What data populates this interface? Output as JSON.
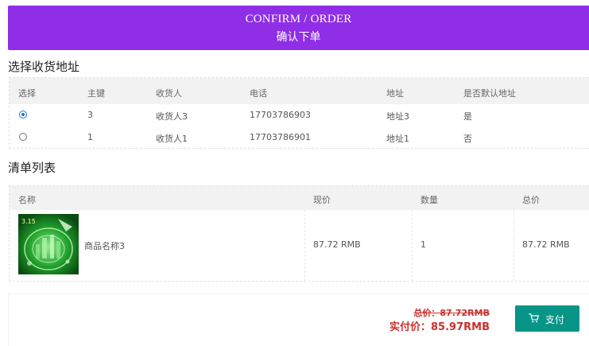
{
  "banner": {
    "title_en": "CONFIRM / ORDER",
    "title_zh": "确认下单"
  },
  "address": {
    "title": "选择收货地址",
    "columns": [
      "选择",
      "主键",
      "收货人",
      "电话",
      "地址",
      "是否默认地址"
    ],
    "rows": [
      {
        "selected": true,
        "id": "3",
        "receiver": "收货人3",
        "phone": "17703786903",
        "address": "地址3",
        "is_default": "是"
      },
      {
        "selected": false,
        "id": "1",
        "receiver": "收货人1",
        "phone": "17703786901",
        "address": "地址1",
        "is_default": "否"
      }
    ]
  },
  "cart": {
    "title": "清单列表",
    "columns": [
      "名称",
      "现价",
      "数量",
      "总价"
    ],
    "items": [
      {
        "name": "商品名称3",
        "price": "87.72 RMB",
        "quantity": "1",
        "total": "87.72 RMB"
      }
    ]
  },
  "summary": {
    "original_total": "总价：87.72RMB",
    "actual_total": "实付价：85.97RMB",
    "pay_label": "支付",
    "pay_icon": "cart-icon",
    "pay_color": "#079587",
    "accent_color": "#8f2ee6",
    "price_color": "#c9302c"
  }
}
